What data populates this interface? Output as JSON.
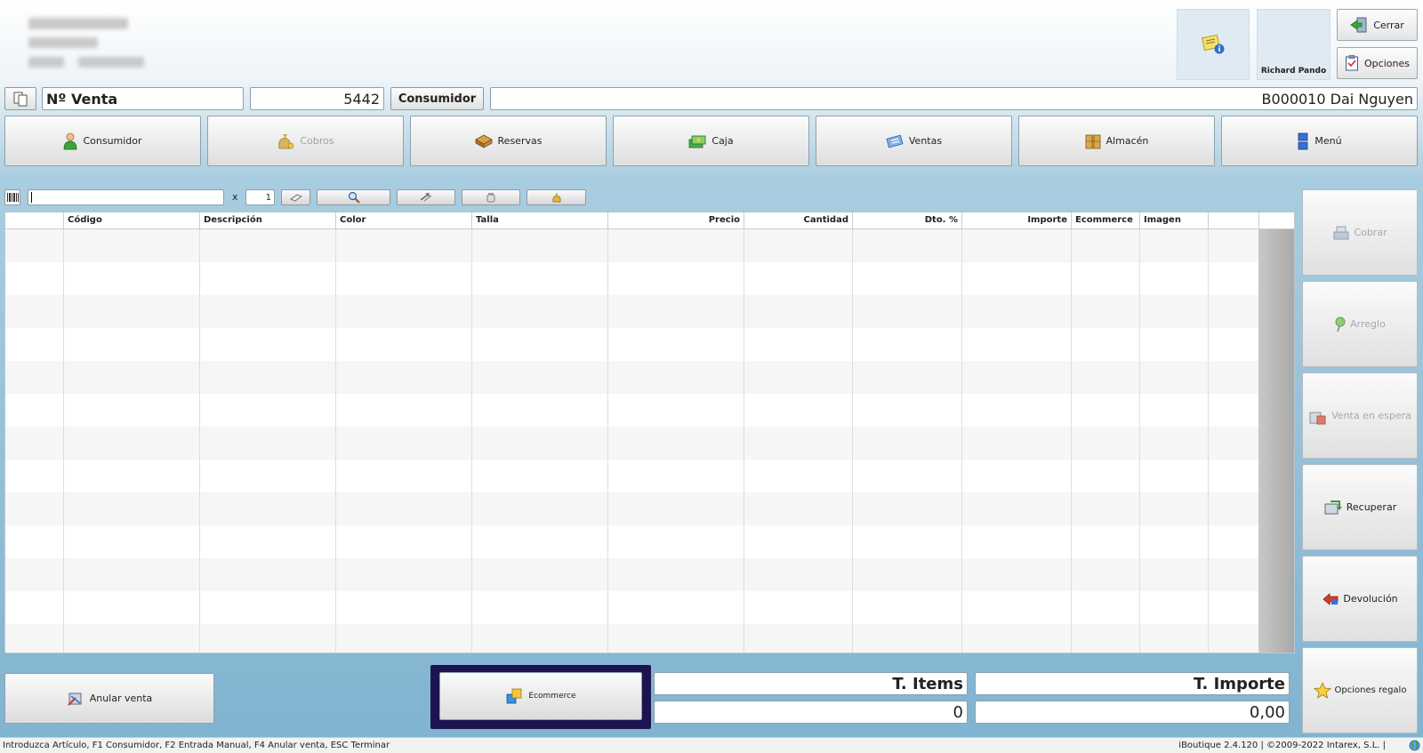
{
  "header": {
    "user_name": "Richard Pando",
    "close_label": "Cerrar",
    "options_label": "Opciones"
  },
  "sale": {
    "sale_number_label": "Nº Venta",
    "sale_number_value": "5442",
    "consumer_label": "Consumidor",
    "consumer_value": "B000010 Dai Nguyen"
  },
  "nav": [
    {
      "label": "Consumidor",
      "icon": "person-icon",
      "enabled": true
    },
    {
      "label": "Cobros",
      "icon": "money-bag-icon",
      "enabled": false
    },
    {
      "label": "Reservas",
      "icon": "box-icon",
      "enabled": true
    },
    {
      "label": "Caja",
      "icon": "cash-icon",
      "enabled": true
    },
    {
      "label": "Ventas",
      "icon": "ticket-icon",
      "enabled": true
    },
    {
      "label": "Almacén",
      "icon": "warehouse-box-icon",
      "enabled": true
    },
    {
      "label": "Menú",
      "icon": "menu-icon",
      "enabled": true
    }
  ],
  "toolbar": {
    "search_value": "",
    "multiplier_label": "x",
    "quantity_value": "1"
  },
  "table": {
    "columns": [
      "",
      "Código",
      "Descripción",
      "Color",
      "Talla",
      "Precio",
      "Cantidad",
      "Dto. %",
      "Importe",
      "Ecommerce",
      "Imagen",
      ""
    ],
    "rows": []
  },
  "side_actions": [
    {
      "label": "Cobrar",
      "icon": "cash-register-icon",
      "enabled": false
    },
    {
      "label": "Arreglo",
      "icon": "pin-icon",
      "enabled": false
    },
    {
      "label": "Venta en espera",
      "icon": "pause-sale-icon",
      "enabled": false
    },
    {
      "label": "Recuperar",
      "icon": "recover-icon",
      "enabled": true
    },
    {
      "label": "Devolución",
      "icon": "return-icon",
      "enabled": true
    },
    {
      "label": "Opciones regalo",
      "icon": "star-icon",
      "enabled": true
    }
  ],
  "bottom": {
    "cancel_label": "Anular venta",
    "ecommerce_label": "Ecommerce",
    "total_items_label": "T. Items",
    "total_items_value": "0",
    "total_amount_label": "T. Importe",
    "total_amount_value": "0,00"
  },
  "status": {
    "hint": "Introduzca Artículo, F1 Consumidor, F2 Entrada Manual, F4 Anular venta, ESC Terminar",
    "version": "iBoutique 2.4.120 | ©2009-2022 Intarex, S.L. |"
  }
}
